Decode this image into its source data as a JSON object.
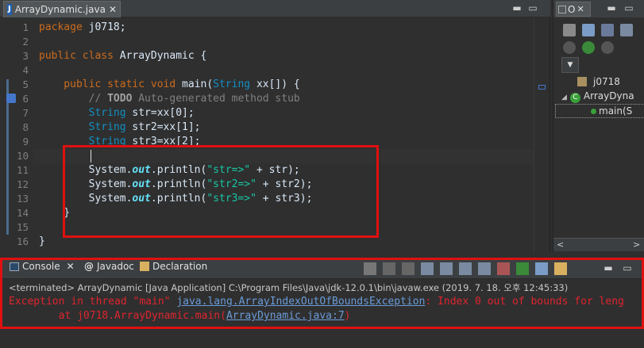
{
  "editor_tab": {
    "label": "ArrayDynamic.java",
    "close": "✕"
  },
  "window_buttons": {
    "minimize": "▬",
    "maximize": "▭"
  },
  "lines": [
    {
      "n": "1"
    },
    {
      "n": "2"
    },
    {
      "n": "3"
    },
    {
      "n": "4"
    },
    {
      "n": "5"
    },
    {
      "n": "6"
    },
    {
      "n": "7"
    },
    {
      "n": "8"
    },
    {
      "n": "9"
    },
    {
      "n": "10"
    },
    {
      "n": "11"
    },
    {
      "n": "12"
    },
    {
      "n": "13"
    },
    {
      "n": "14"
    },
    {
      "n": "15"
    },
    {
      "n": "16"
    }
  ],
  "code": {
    "l1": {
      "kw": "package",
      "rest": " j0718;"
    },
    "l3": {
      "kw": "public class",
      "name": " ArrayDynamic {"
    },
    "l5": {
      "kw": "    public static void",
      "name": " main(",
      "ty": "String",
      "rest": " xx[]) {"
    },
    "l6": {
      "pre": "        // ",
      "todo": "TODO",
      "rest": " Auto-generated method stub"
    },
    "l7": {
      "ty": "        String",
      "rest": " str=xx[0];"
    },
    "l8": {
      "ty": "        String",
      "rest": " str2=xx[1];"
    },
    "l9": {
      "ty": "        String",
      "rest": " str3=xx[2];"
    },
    "l11": {
      "pre": "        System.",
      "fld": "out",
      "mid": ".println(",
      "str": "\"str=>\"",
      "rest": " + str);"
    },
    "l12": {
      "pre": "        System.",
      "fld": "out",
      "mid": ".println(",
      "str": "\"str2=>\"",
      "rest": " + str2);"
    },
    "l13": {
      "pre": "        System.",
      "fld": "out",
      "mid": ".println(",
      "str": "\"str3=>\"",
      "rest": " + str3);"
    },
    "l14": {
      "rest": "    }"
    },
    "l16": {
      "rest": "}"
    }
  },
  "outline": {
    "tab_label": "O",
    "close": "✕",
    "package": "j0718",
    "class": "ArrayDyna",
    "method": "main(S"
  },
  "bottom_tabs": {
    "console": "Console",
    "javadoc": "Javadoc",
    "declaration": "Declaration"
  },
  "console": {
    "terminated": "<terminated> ArrayDynamic [Java Application] C:\\Program Files\\Java\\jdk-12.0.1\\bin\\javaw.exe (2019. 7. 18. 오후 12:45:33)",
    "exc_pre": "Exception in thread \"main\" ",
    "exc_link": "java.lang.ArrayIndexOutOfBoundsException",
    "exc_post": ": Index 0 out of bounds for leng",
    "at_pre": "        at j0718.ArrayDynamic.main(",
    "at_link": "ArrayDynamic.java:7",
    "at_post": ")"
  },
  "colors": {
    "highlight": "#e01010",
    "link": "#6a9bd8",
    "error": "#e0242e"
  }
}
